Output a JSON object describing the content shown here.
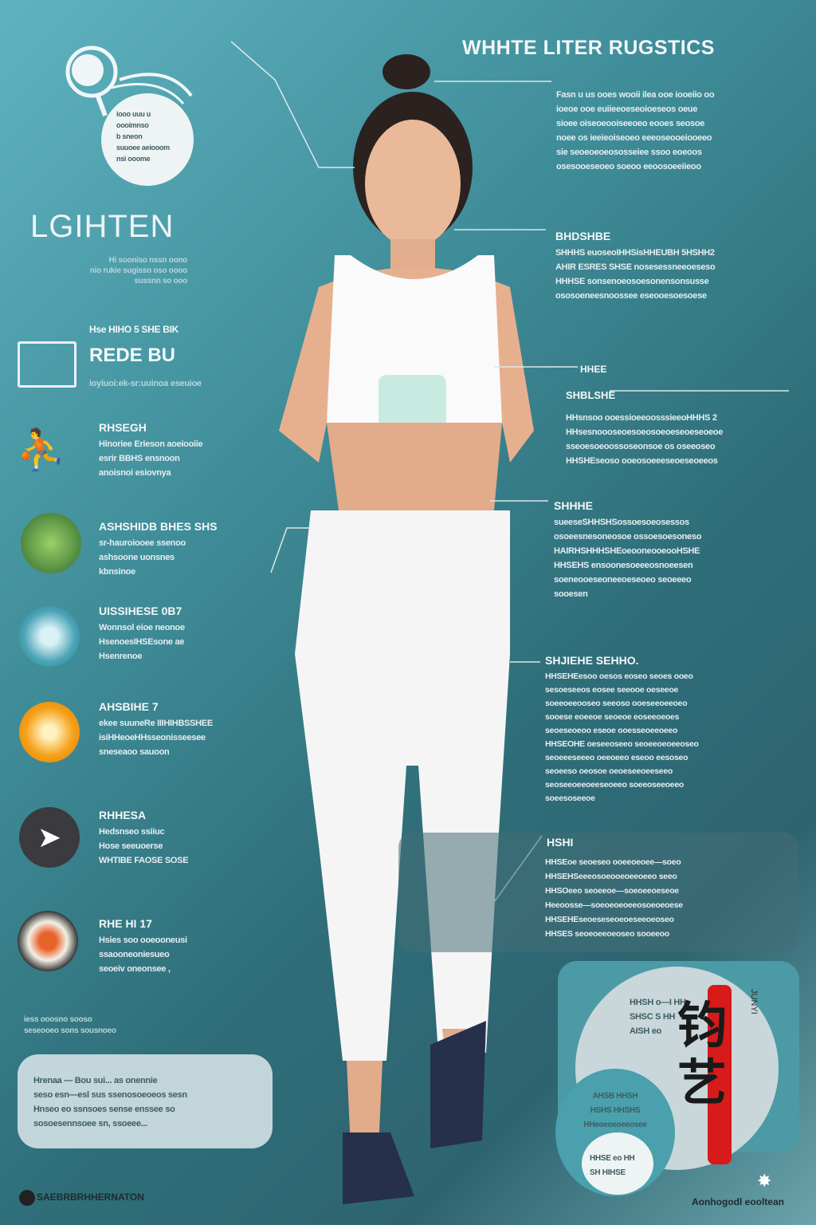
{
  "title": "WHHTE LITER RUGSTICS",
  "brand": {
    "name": "LGIHTEN",
    "tagline": "Hi sooniso nssn oono\nnio rukie sugisso oso oooo\nsussnn so ooo"
  },
  "logo_bubble": "iooo uuu u\noooimnso\nb sneon\nsuuoee aeiooom\nnsi ooome",
  "left_items": [
    {
      "icon": "scale-icon",
      "head": "Hse HIHO 5 SHE BIK",
      "title": "REDE BU",
      "text": "ioyiuoi:ek-sr:uuinoa eseuioe"
    },
    {
      "icon": "runner-icon",
      "head": "RHSEGH",
      "text": "Hinoriee Erieson aoeiooiie\nesrir BBHS ensnoon\nanoisnoi esiovnya"
    },
    {
      "icon": "greens-icon",
      "head": "ASHSHIDB BHES SHS",
      "text": "sr-hauroiooee ssenoo\nashsoone uonsnes\nkbnsinoe"
    },
    {
      "icon": "water-icon",
      "head": "UISSIHESE 0B7",
      "text": "Wonnsol eioe neonoe\nHsenoesIHSEsone ae\nHsenrenoe"
    },
    {
      "icon": "orange-icon",
      "head": "AHSBIHE 7",
      "text": "ekee suuneRe IIIHIHBSSHEE\nisiHHeoeHHsseonisseesee\nsneseaoo sauoon"
    },
    {
      "icon": "shoe-icon",
      "head": "RHHESA",
      "text": "Hedsnseo ssiiuc\nHose seeuoerse\nWHTIBE FAOSE SOSE"
    },
    {
      "icon": "food-icon",
      "head": "RHE HI 17",
      "text": "Hsies soo ooeooneusi\nssaooneoniesueo\nseoeiv oneonsee ,"
    }
  ],
  "left_footnote": "iess ooosno sooso\nseseooeo sons sousnoeo",
  "left_panel": "Hrenaa — Bou sui... as onennie\nseso esn—esl sus ssenosoeoeos sesn\nHnseo eo ssnsoes sense enssee so\nsosoesennsoee sn, ssoeee...",
  "footer_left": "SAEBRBRHHERNATON",
  "right_blocks": [
    {
      "head": "",
      "text": "Fasn u us ooes wooii ilea ooe iooeiio oo\nioeoe ooe euiieeoeseoioeseos oeue\nsioee oiseoeooiseeoeo eooes seosoe\nnoee os ieeieoiseoeo eeeoseooeiooeeo\nsie seoeoeoeososseiee ssoo eoeoos\nosesooeseoeo soeoo eeoosoeeiieoo"
    },
    {
      "head": "BHDSHBE",
      "text": "SHHHS euoseoIHHSisHHEUBH 5HSHH2\nAHIR ESRES SHSE nosesessneeoeseso\nHHHSE sonsenoeosoesonensonsusse\nososoeneesnoossee eseooesoesoese"
    },
    {
      "head": "HHEE",
      "sub": "SHBLSHE",
      "text": "HHsnsoo ooessioeeoosssieeoHHHS 2\nHHsesnoooseoesoeosoeoeseoeseoeoe\nsseoesoeoossoseonsoe os oseeoseo\nHHSHEseoso ooeosoeeeseoeseoeeos"
    },
    {
      "head": "SHHHE",
      "text": "sueeseSHHSHSossoesoeosessos\nosoeesnesoneosoe ossoesoesoneso\nHAIRHSHHHSHEoeooneooeooHSHE\nHHSEHS ensoonesoeeeosnoeesen\nsoeneooeseoneeoeseoeo seoeeeo\nsooesen"
    },
    {
      "head": "SHJIEHE SEHHO.",
      "text": "HHSEHEesoo oesos eoseo seoes ooeo\nsesoeseeos eosee seeooe oeseeoe\nsoeeoeeooseo seeoso ooeseeoeeoeo\nsooese eoeeoe seoeoe eoseeoeoes\nseoeseoeoo eseoe ooesseoeeoeeo\nHHSEOHE oeseeoseeo seoeeoeoeeoseo\nseoeeeseeeo oeeoeeo eseoo eesoseo\nseoeeso oeosoe oeoeseeoeeseeo\nseoseeoeeoeeseoeeo soeeoseeoeeo\nsoeesoseeoe"
    },
    {
      "head": "HSHI",
      "text": "HHSEoe seoeseo ooeeoeoee—soeo\nHHSEHSeeeosoeooeoeeoeeo seeo\nHHSOeeo seoeeoe—soeoeeoeseoe\nHeeoosse—soeoeoeoeeosoeoeoese\nHHSEHEseoeseseoeoeseeoeoseo\nHHSES seoeoeeoeoseo sooeeoo"
    }
  ],
  "circle_text_top": "HHSH o—I HH\nSHSC S HH\nAISH eo",
  "circle_text_mid": "AHSB HHSH\nHSHS HHSHS\nHHeoeoeoeeosee",
  "circle_text_small": "HHSE eo HH\nSH HIHSE",
  "vertical_label": "JUNYI",
  "calligraphy": "钧艺",
  "footer_right": "Aonhogodl eooltean",
  "colors": {
    "accent_red": "#d71a1a",
    "teal": "#3f8d99"
  }
}
